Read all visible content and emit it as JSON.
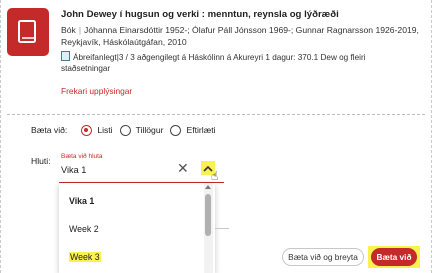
{
  "book": {
    "title": "John Dewey í hugsun og verki : menntun, reynsla og lýðræði",
    "type": "Bók",
    "authors": "Jóhanna Einarsdóttir 1952-; Ólafur Páll Jónsson 1969-; Gunnar Ragnarsson 1926-2019, Reykjavík, Háskólaútgáfan, 2010",
    "availability_type": "Ábreifanlegt",
    "availability": "3 / 3 aðgengilegt á Háskólinn á Akureyri 1 dagur: 370.1 Dew og fleiri staðsetningar",
    "more_info": "Frekari upplýsingar",
    "icon": "book-icon",
    "accent_color": "#c52a2a"
  },
  "add_to": {
    "label": "Bæta við:",
    "options": [
      {
        "label": "Listi",
        "checked": true
      },
      {
        "label": "Tillögur",
        "checked": false
      },
      {
        "label": "Eftirlæti",
        "checked": false
      }
    ]
  },
  "section": {
    "label": "Hluti:",
    "field_label": "Bæta við hluta",
    "value": "Vika 1",
    "clear_icon": "close-icon",
    "toggle_icon": "chevron-up-icon",
    "options": [
      "Vika 1",
      "Week 2",
      "Week 3"
    ],
    "highlight_color": "#fbf250"
  },
  "buttons": {
    "add_edit": "Bæta við og breyta",
    "add": "Bæta við"
  }
}
